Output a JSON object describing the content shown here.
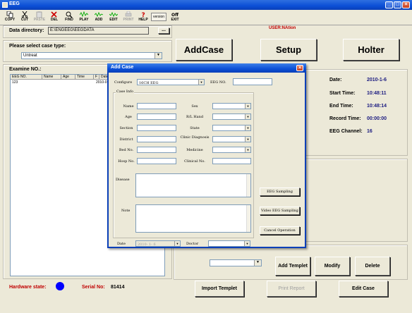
{
  "window": {
    "title": "EEG"
  },
  "toolbar": {
    "items": [
      {
        "label": "COPY",
        "icon": "copy-icon"
      },
      {
        "label": "CUT",
        "icon": "cut-icon"
      },
      {
        "label": "PASTE",
        "icon": "paste-icon",
        "disabled": true
      },
      {
        "label": "DEL",
        "icon": "delete-icon"
      },
      {
        "label": "FIND",
        "icon": "find-icon"
      },
      {
        "label": "PLAY",
        "icon": "play-icon"
      },
      {
        "label": "ADD",
        "icon": "add-icon"
      },
      {
        "label": "EDIT",
        "icon": "edit-icon"
      },
      {
        "label": "PRINT",
        "icon": "print-icon",
        "disabled": true
      },
      {
        "label": "HELP",
        "icon": "help-icon"
      },
      {
        "label": "version",
        "icon": ""
      },
      {
        "label": "EXIT",
        "icon": "exit-icon"
      }
    ]
  },
  "left": {
    "data_dir_label": "Data directory:",
    "data_dir_value": "E:\\ENGEEG\\EEGDATA",
    "browse_label": "...",
    "case_type_label": "Please select case type:",
    "case_type_value": "Untreat",
    "examine_label": "Examine NO.:",
    "grid_headers": [
      "EEG NO.",
      "Name",
      "Age",
      "Time",
      "F",
      "Date"
    ],
    "grid_row": {
      "no": "123",
      "date": "2010-0"
    },
    "hardware_label": "Hardware state:",
    "serial_label": "Serial No:",
    "serial_value": "81414"
  },
  "header": {
    "user": "USER:NAtion"
  },
  "main_buttons": {
    "addcase": "AddCase",
    "setup": "Setup",
    "holter": "Holter"
  },
  "info": {
    "date_label": "Date:",
    "date_value": "2010-1-6",
    "start_label": "Start Time:",
    "start_value": "10:48:11",
    "end_label": "End Time:",
    "end_value": "10:48:14",
    "record_label": "Record Time:",
    "record_value": "00:00:00",
    "channel_label": "EEG Channel:",
    "channel_value": "16"
  },
  "bottom": {
    "add_templet": "Add Templet",
    "modify": "Modify",
    "delete": "Delete",
    "import_templet": "Import Templet",
    "print_report": "Print Report",
    "edit_case": "Edit Case"
  },
  "dialog": {
    "title": "Add Case",
    "configure_label": "Configure",
    "configure_value": "16CH EEG",
    "eeg_no_label": "EEG NO.",
    "case_info_label": "Case Info",
    "name_label": "Name",
    "age_label": "Age",
    "section_label": "Section",
    "district_label": "District",
    "bed_label": "Bed No.",
    "hosp_label": "Hosp No.",
    "sex_label": "Sex",
    "hand_label": "R/L Hand",
    "state_label": "State",
    "clinic_label": "Clinic Diagnosis",
    "medicine_label": "Medicine",
    "clinical_label": "Clinical No.",
    "disease_label": "Disease",
    "note_label": "Note",
    "date_label": "Date",
    "date_value": "2010- 1- 6",
    "doctor_label": "Doctor",
    "eeg_sampling": "EEG Sampling",
    "video_sampling": "Video EEG Sampling",
    "cancel": "Cancel Operation"
  },
  "colors": {
    "title_blue": "#0b4fd6",
    "status_blue": "#0000ff",
    "red_label": "#c00000"
  }
}
